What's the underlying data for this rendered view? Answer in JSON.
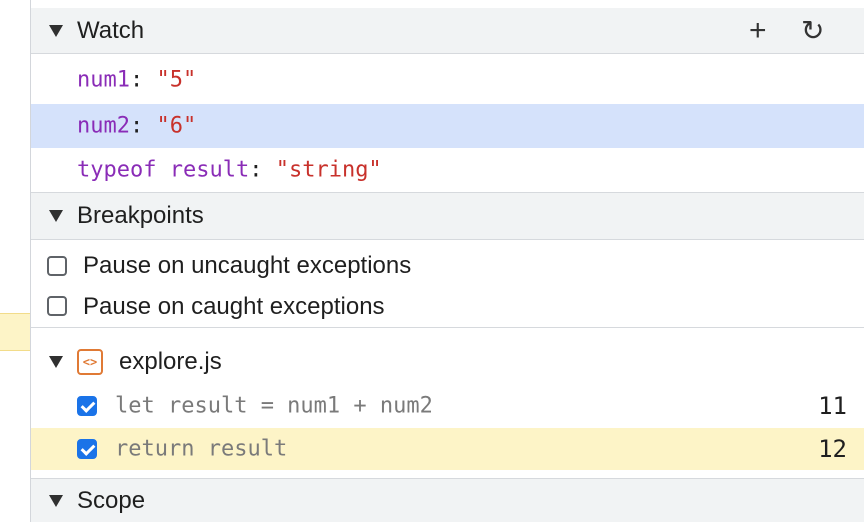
{
  "watch": {
    "title": "Watch",
    "add_icon": "+",
    "refresh_icon": "↻",
    "items": [
      {
        "name": "num1",
        "colon": ":",
        "value": "\"5\""
      },
      {
        "name": "num2",
        "colon": ":",
        "value": "\"6\""
      },
      {
        "name_kw": "typeof",
        "name": "result",
        "colon": ":",
        "value": "\"string\""
      }
    ]
  },
  "breakpoints": {
    "title": "Breakpoints",
    "pause_uncaught": "Pause on uncaught exceptions",
    "pause_caught": "Pause on caught exceptions",
    "file": {
      "icon": "<>",
      "name": "explore.js",
      "entries": [
        {
          "code": "let result = num1 + num2",
          "line": "11",
          "checked": true
        },
        {
          "code": "return result",
          "line": "12",
          "checked": true
        }
      ]
    }
  },
  "scope": {
    "title": "Scope"
  },
  "colors": {
    "keyword": "#8a2cb7",
    "string": "#c8312b",
    "selected_row": "#d5e2fb",
    "paused_line": "#fdf4c7",
    "checkbox_accent": "#1a73e8"
  }
}
